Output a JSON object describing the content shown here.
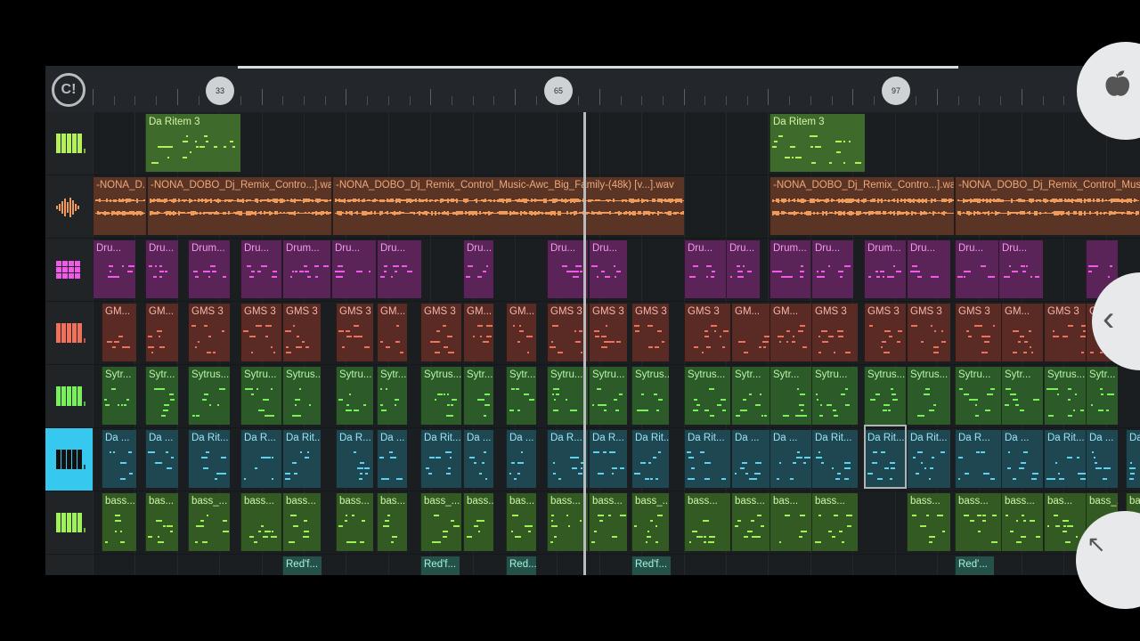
{
  "ruler": {
    "markers": [
      "33",
      "65",
      "97"
    ]
  },
  "tracks": [
    {
      "name": "track-1",
      "color": "#b4f05a",
      "icon": "piano-icon"
    },
    {
      "name": "track-2",
      "color": "#f09a5a",
      "icon": "waveform-icon"
    },
    {
      "name": "track-3",
      "color": "#f05ae6",
      "icon": "drum-pads-icon"
    },
    {
      "name": "track-4",
      "color": "#f0705a",
      "icon": "piano-icon"
    },
    {
      "name": "track-5",
      "color": "#78f05a",
      "icon": "piano-icon"
    },
    {
      "name": "track-6",
      "color": "#ffffff",
      "icon": "piano-icon",
      "selected": true
    },
    {
      "name": "track-7",
      "color": "#a0f05a",
      "icon": "piano-icon"
    },
    {
      "name": "track-8",
      "color": "#78e0c8",
      "icon": "piano-icon"
    }
  ],
  "clip_labels": {
    "ritem": "Da Ritem 3",
    "audio": [
      "-NONA_D...",
      "-NONA_DOBO_Dj_Remix_Contro...].wav",
      "-NONA_DOBO_Dj_Remix_Control_Music-Awc_Big_Family-(48k) [v...].wav",
      "-NONA_DOBO_Dj_Remix_Contro...].wav",
      "-NONA_DOBO_Dj_Remix_Control_Music-"
    ],
    "drum": [
      "Dru...",
      "Dru...",
      "Drum...",
      "Dru...",
      "Drum...",
      "Dru...",
      "Dru...",
      "Dru...",
      "Dru...",
      "Dru...",
      "Dru...",
      "Dru...",
      "Drum...",
      "Dru...",
      "Drum...",
      "Dru...",
      "Dru...",
      "Dru..."
    ],
    "gms": [
      "GM...",
      "GM...",
      "GMS 3",
      "GMS 3",
      "GMS 3",
      "GMS 3",
      "GM...",
      "GMS 3",
      "GM...",
      "GM...",
      "GMS 3",
      "GMS 3",
      "GMS 3",
      "GMS 3",
      "GM...",
      "GM...",
      "GMS 3",
      "GMS 3",
      "GMS 3",
      "GMS 3",
      "GM...",
      "GMS 3",
      "G"
    ],
    "sytrus": [
      "Sytr...",
      "Sytr...",
      "Sytrus...",
      "Sytru...",
      "Sytrus...",
      "Sytru...",
      "Sytr...",
      "Sytrus...",
      "Sytr...",
      "Sytr...",
      "Sytru...",
      "Sytru...",
      "Sytrus...",
      "Sytrus...",
      "Sytr...",
      "Sytr...",
      "Sytru...",
      "Sytrus...",
      "Sytrus...",
      "Sytru...",
      "Sytr...",
      "Sytrus...",
      "Sytr..."
    ],
    "ritem_lane": [
      "Da ...",
      "Da ...",
      "Da Rit...",
      "Da R...",
      "Da Rit...",
      "Da R...",
      "Da ...",
      "Da Rit...",
      "Da ...",
      "Da ...",
      "Da R...",
      "Da R...",
      "Da Rit...",
      "Da Rit...",
      "Da ...",
      "Da ...",
      "Da Rit...",
      "Da Rit...",
      "Da Rit...",
      "Da R...",
      "Da ...",
      "Da Rit...",
      "Da ...",
      "Da"
    ],
    "bass": [
      "bass...",
      "bas...",
      "bass_...",
      "bass...",
      "bass...",
      "bass...",
      "bas...",
      "bass_...",
      "bass...",
      "bas...",
      "bass...",
      "bass...",
      "bass_...",
      "bass...",
      "bass...",
      "bas...",
      "bass...",
      "bass...",
      "bass...",
      "bass...",
      "bas...",
      "bass_...",
      "bass..."
    ],
    "red": [
      "Red'f...",
      "Red'f...",
      "Red...",
      "Red'f...",
      "Red'..."
    ]
  }
}
